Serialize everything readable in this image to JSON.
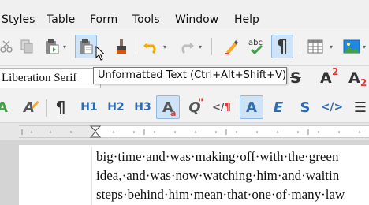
{
  "menubar": {
    "items": [
      {
        "label": "Styles",
        "underline": "S"
      },
      {
        "label": "Table",
        "underline": "a"
      },
      {
        "label": "Form",
        "underline": "o"
      },
      {
        "label": "Tools",
        "underline": "T"
      },
      {
        "label": "Window",
        "underline": "W"
      },
      {
        "label": "Help",
        "underline": "H"
      }
    ]
  },
  "toolbar": {
    "font_name": "Liberation Serif",
    "tooltip": "Unformatted Text (Ctrl+Alt+Shift+V)",
    "buttons": [
      "cut-icon",
      "copy-icon",
      "paste-icon",
      "paste-unformatted-icon",
      "clone-formatting-icon",
      "undo-icon",
      "redo-icon",
      "highlighter-icon",
      "spellcheck-icon",
      "formatting-marks-icon",
      "insert-table-icon",
      "insert-image-icon"
    ],
    "spellcheck_label": "abc"
  },
  "styles_bar": {
    "h1": "H1",
    "h2": "H2",
    "h3": "H3"
  },
  "document": {
    "lines": [
      "big·time·and·was·making·off·with·the·green",
      "idea,·and·was·now·watching·him·and·waitin",
      "steps·behind·him·mean·that·one·of·many·law"
    ]
  },
  "colors": {
    "accent": "#2d6bb3",
    "active_bg": "#cfe3f6",
    "active_border": "#8fb9e2"
  }
}
